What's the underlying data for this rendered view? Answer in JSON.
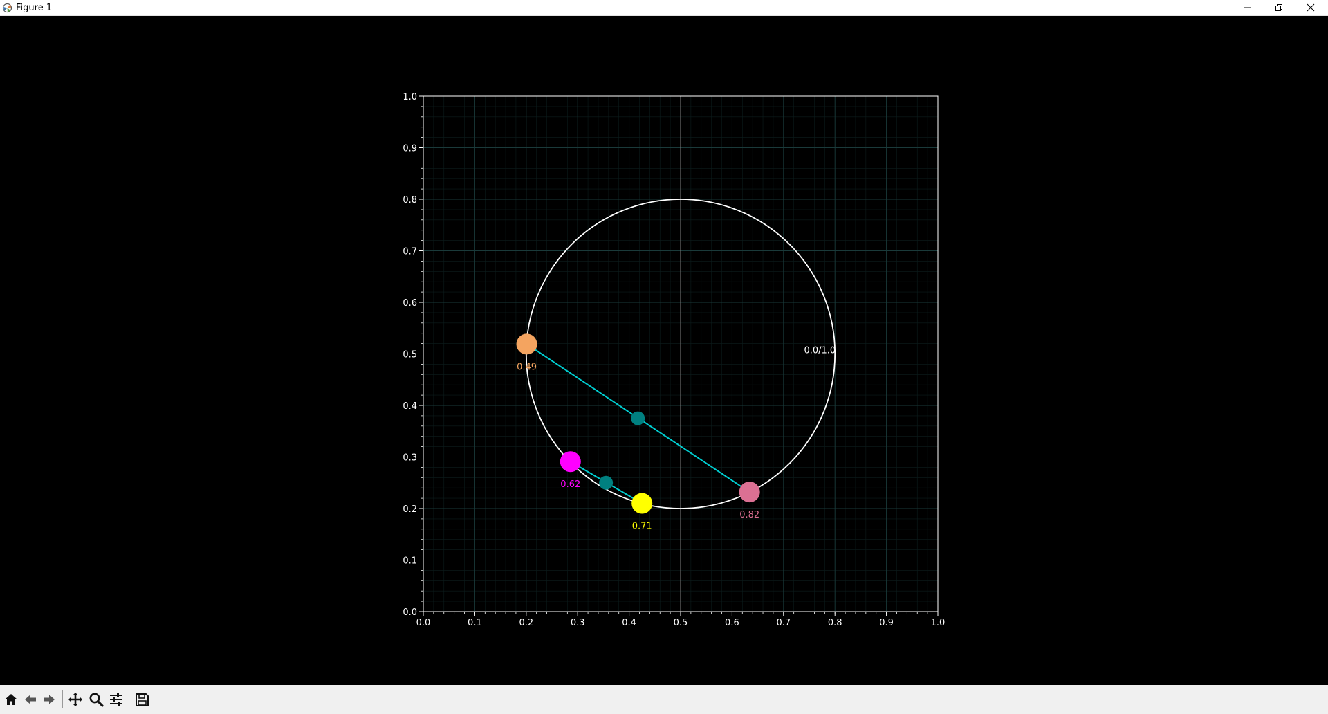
{
  "window": {
    "title": "Figure 1",
    "icons": {
      "app": "matplotlib-icon",
      "minimize": "minimize-icon",
      "maximize": "restore-icon",
      "close": "close-icon"
    }
  },
  "toolbar": {
    "items": [
      {
        "name": "home-button",
        "icon": "home-icon"
      },
      {
        "name": "back-button",
        "icon": "arrow-left-icon"
      },
      {
        "name": "forward-button",
        "icon": "arrow-right-icon"
      },
      {
        "name": "pan-button",
        "icon": "move-icon"
      },
      {
        "name": "zoom-button",
        "icon": "magnifier-icon"
      },
      {
        "name": "configure-subplots-button",
        "icon": "sliders-icon"
      },
      {
        "name": "save-button",
        "icon": "floppy-disk-icon"
      }
    ]
  },
  "chart_data": {
    "type": "scatter",
    "title": "",
    "xlabel": "",
    "ylabel": "",
    "xlim": [
      0.0,
      1.0
    ],
    "ylim": [
      0.0,
      1.0
    ],
    "xticks": [
      "0.0",
      "0.1",
      "0.2",
      "0.3",
      "0.4",
      "0.5",
      "0.6",
      "0.7",
      "0.8",
      "0.9",
      "1.0"
    ],
    "yticks": [
      "0.0",
      "0.1",
      "0.2",
      "0.3",
      "0.4",
      "0.5",
      "0.6",
      "0.7",
      "0.8",
      "0.9",
      "1.0"
    ],
    "grid": true,
    "minor_grid": true,
    "background": "#000000",
    "axes_color": "#ffffff",
    "grid_color": "#1a3a3a",
    "crosshair": {
      "x": 0.5,
      "y": 0.5,
      "color": "#7f7f7f"
    },
    "circle": {
      "center": [
        0.5,
        0.5
      ],
      "radius": 0.3,
      "color": "#ffffff"
    },
    "circle_label": {
      "text": "0.0/1.0",
      "x": 0.8,
      "y": 0.5,
      "color": "#ffffff"
    },
    "points": [
      {
        "label": "0.49",
        "x": 0.201,
        "y": 0.519,
        "color": "#f4a460"
      },
      {
        "label": "0.62",
        "x": 0.286,
        "y": 0.291,
        "color": "#ff00ff"
      },
      {
        "label": "0.71",
        "x": 0.425,
        "y": 0.21,
        "color": "#ffff00"
      },
      {
        "label": "0.82",
        "x": 0.634,
        "y": 0.232,
        "color": "#db7093"
      }
    ],
    "chords": [
      {
        "from": [
          0.201,
          0.519
        ],
        "to": [
          0.634,
          0.232
        ],
        "color": "#00ced1"
      },
      {
        "from": [
          0.286,
          0.291
        ],
        "to": [
          0.425,
          0.21
        ],
        "color": "#00ced1"
      }
    ],
    "midpoints": [
      {
        "x": 0.417,
        "y": 0.375,
        "color": "#008080"
      },
      {
        "x": 0.355,
        "y": 0.25,
        "color": "#008080"
      }
    ]
  }
}
